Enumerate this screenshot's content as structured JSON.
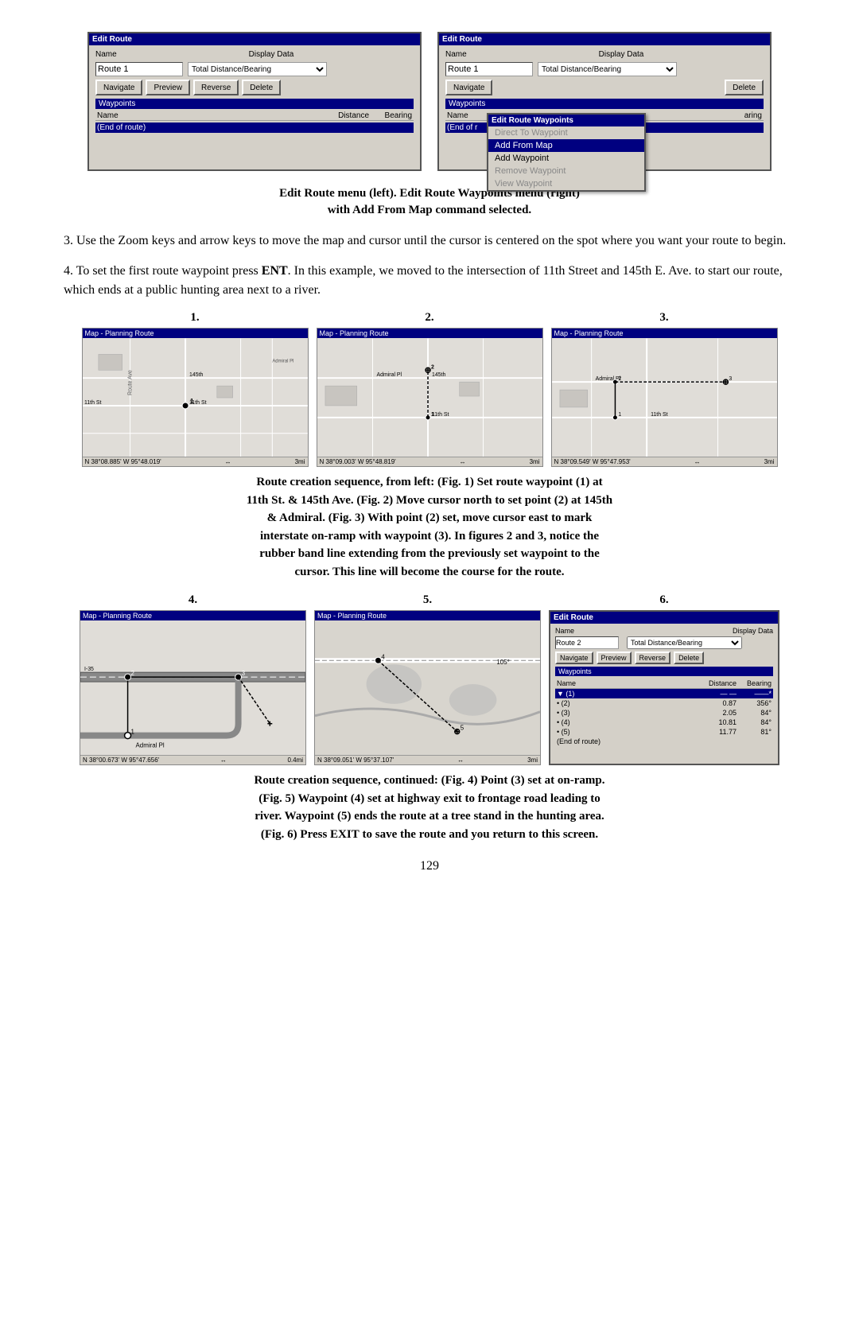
{
  "dialogs": {
    "left": {
      "title": "Edit Route",
      "name_label": "Name",
      "display_data_label": "Display Data",
      "route_name": "Route 1",
      "display_option": "Total Distance/Bearing",
      "buttons": [
        "Navigate",
        "Preview",
        "Reverse",
        "Delete"
      ],
      "waypoints_header": "Waypoints",
      "table_cols": [
        "Name",
        "Distance",
        "Bearing"
      ],
      "table_rows": [
        [
          "(End of route)"
        ]
      ]
    },
    "right": {
      "title": "Edit Route",
      "name_label": "Name",
      "display_data_label": "Display Data",
      "route_name": "Route 1",
      "display_option": "Total Distance/Bearing",
      "buttons_visible": [
        "Navigate",
        "Delete"
      ],
      "waypoints_header": "Waypoints",
      "table_cols": [
        "Name",
        "Bearing"
      ],
      "table_rows": [
        [
          "(End of r"
        ]
      ]
    },
    "popup": {
      "title": "Edit Route Waypoints",
      "items": [
        {
          "label": "Direct To Waypoint",
          "state": "disabled"
        },
        {
          "label": "Add From Map",
          "state": "active"
        },
        {
          "label": "Add Waypoint",
          "state": "enabled"
        },
        {
          "label": "Remove Waypoint",
          "state": "disabled"
        },
        {
          "label": "View Waypoint",
          "state": "disabled"
        }
      ]
    }
  },
  "caption_top": {
    "line1": "Edit Route menu (left). Edit Route Waypoints menu (right)",
    "line2": "with Add From Map command selected."
  },
  "paragraph1": "3. Use the Zoom keys and arrow keys to move the map and cursor until the cursor is centered on the spot where you want your route to begin.",
  "paragraph2_parts": {
    "before": "4. To set the first route waypoint press ",
    "bold": "ENT",
    "after": ". In this example, we moved to the intersection of 11th Street and 145th E. Ave. to start our route, which ends at a public hunting area next to a river."
  },
  "figures_row1": {
    "labels": [
      "1.",
      "2.",
      "3."
    ],
    "maps": [
      {
        "titlebar": "Map - Planning Route",
        "statusbar_left": "N 38°08.885'  W 95°48.019'",
        "statusbar_right": "3mi",
        "statusbar_arrows": "↔"
      },
      {
        "titlebar": "Map - Planning Route",
        "statusbar_left": "N 38°09.003'  W 95°48.819'",
        "statusbar_right": "3mi",
        "statusbar_arrows": "↔"
      },
      {
        "titlebar": "Map - Planning Route",
        "statusbar_left": "N 38°09.549'  W 95°47.953'",
        "statusbar_right": "3mi",
        "statusbar_arrows": "↔"
      }
    ]
  },
  "caption_middle": {
    "line1": "Route creation sequence, from left: (Fig. 1) Set route waypoint (1) at",
    "line2": "11th St. & 145th Ave. (Fig. 2) Move cursor north to set point (2) at 145th",
    "line3": "& Admiral. (Fig. 3) With point (2) set, move cursor east to mark",
    "line4": "interstate on-ramp with waypoint (3). In figures 2 and 3, notice the",
    "line5": "rubber band line extending from the previously set waypoint to the",
    "line6": "cursor. This line will become the course for the route."
  },
  "figures_row2": {
    "labels": [
      "4.",
      "5.",
      "6."
    ],
    "maps": [
      {
        "titlebar": "Map - Planning Route",
        "statusbar_left": "N 38°00.673'  W 95°47.656'",
        "statusbar_right": "0.4mi",
        "statusbar_arrows": "↔"
      },
      {
        "titlebar": "Map - Planning Route",
        "statusbar_left": "N 38°09.051'  W 95°37.107'",
        "statusbar_right": "3mi",
        "statusbar_arrows": "↔"
      }
    ],
    "fig6_dialog": {
      "title": "Edit Route",
      "name_label": "Name",
      "display_data_label": "Display Data",
      "route_name": "Route 2",
      "display_option": "Total Distance/Bearing",
      "buttons": [
        "Navigate",
        "Preview",
        "Reverse",
        "Delete"
      ],
      "waypoints_header": "Waypoints",
      "table_cols": [
        "Name",
        "Distance",
        "Bearing"
      ],
      "waypoints": [
        {
          "indent": "▼ (1)",
          "dist": "— —",
          "bearing": "——*"
        },
        {
          "indent": "• (2)",
          "dist": "0.87",
          "bearing": "356°"
        },
        {
          "indent": "• (3)",
          "dist": "2.05",
          "bearing": "84°"
        },
        {
          "indent": "• (4)",
          "dist": "10.81",
          "bearing": "84°"
        },
        {
          "indent": "• (5)",
          "dist": "11.77",
          "bearing": "81°"
        },
        {
          "indent": "(End of route)",
          "dist": "",
          "bearing": ""
        }
      ]
    }
  },
  "caption_bottom": {
    "line1": "Route creation sequence, continued: (Fig. 4) Point (3) set at on-ramp.",
    "line2": "(Fig. 5) Waypoint (4) set at highway exit to frontage road leading to",
    "line3": "river. Waypoint (5) ends the route at a tree stand in the hunting area.",
    "line4_before": "(Fig. 6) Press ",
    "line4_bold": "EXIT",
    "line4_after": " to save the route and you return to this screen."
  },
  "page_number": "129"
}
